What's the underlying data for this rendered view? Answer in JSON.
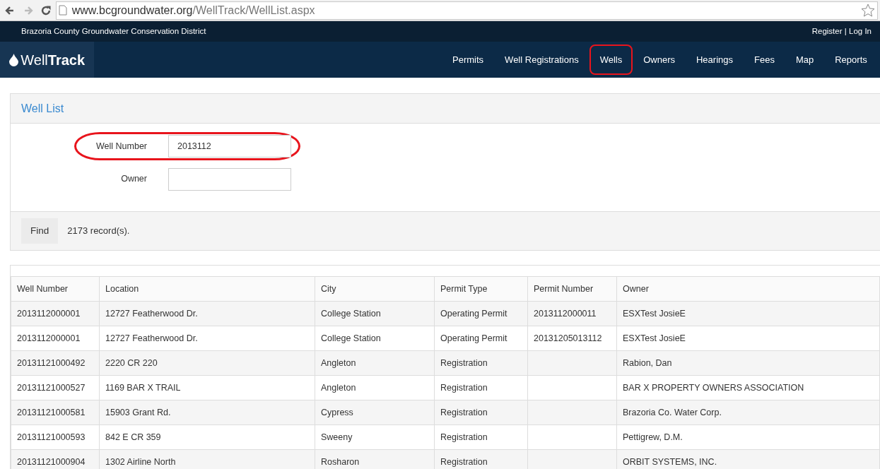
{
  "browser": {
    "back_disabled": false,
    "forward_disabled": true,
    "url_host": "www.bcgroundwater.org",
    "url_path": "/WellTrack/WellList.aspx"
  },
  "top_bar": {
    "org": "Brazoria County Groundwater Conservation District",
    "links": [
      "Register",
      "Log In"
    ],
    "separator": "|"
  },
  "brand": {
    "light": "Well",
    "bold": "Track"
  },
  "nav": [
    {
      "label": "Permits",
      "circled": false
    },
    {
      "label": "Well Registrations",
      "circled": false
    },
    {
      "label": "Wells",
      "circled": true
    },
    {
      "label": "Owners",
      "circled": false
    },
    {
      "label": "Hearings",
      "circled": false
    },
    {
      "label": "Fees",
      "circled": false
    },
    {
      "label": "Map",
      "circled": false
    },
    {
      "label": "Reports",
      "circled": false
    }
  ],
  "search_panel": {
    "title": "Well List",
    "fields": [
      {
        "label": "Well Number",
        "value": "2013112",
        "circled": true
      },
      {
        "label": "Owner",
        "circled": false
      }
    ],
    "button": "Find",
    "record_count": "2173 record(s)."
  },
  "table": {
    "columns": [
      "Well Number",
      "Location",
      "City",
      "Permit Type",
      "Permit Number",
      "Owner"
    ],
    "rows": [
      [
        "2013112000001",
        "12727 Featherwood Dr.",
        "College Station",
        "Operating Permit",
        "2013112000011",
        "ESXTest JosieE"
      ],
      [
        "2013112000001",
        "12727 Featherwood Dr.",
        "College Station",
        "Operating Permit",
        "20131205013112",
        "ESXTest JosieE"
      ],
      [
        "20131121000492",
        "2220 CR 220",
        "Angleton",
        "Registration",
        "",
        "Rabion, Dan"
      ],
      [
        "20131121000527",
        "1169 BAR X TRAIL",
        "Angleton",
        "Registration",
        "",
        "BAR X PROPERTY OWNERS ASSOCIATION"
      ],
      [
        "20131121000581",
        "15903 Grant Rd.",
        "Cypress",
        "Registration",
        "",
        "Brazoria Co. Water Corp."
      ],
      [
        "20131121000593",
        "842 E CR 359",
        "Sweeny",
        "Registration",
        "",
        "Pettigrew, D.M."
      ],
      [
        "20131121000904",
        "1302 Airline North",
        "Rosharon",
        "Registration",
        "",
        "ORBIT SYSTEMS, INC."
      ]
    ]
  }
}
